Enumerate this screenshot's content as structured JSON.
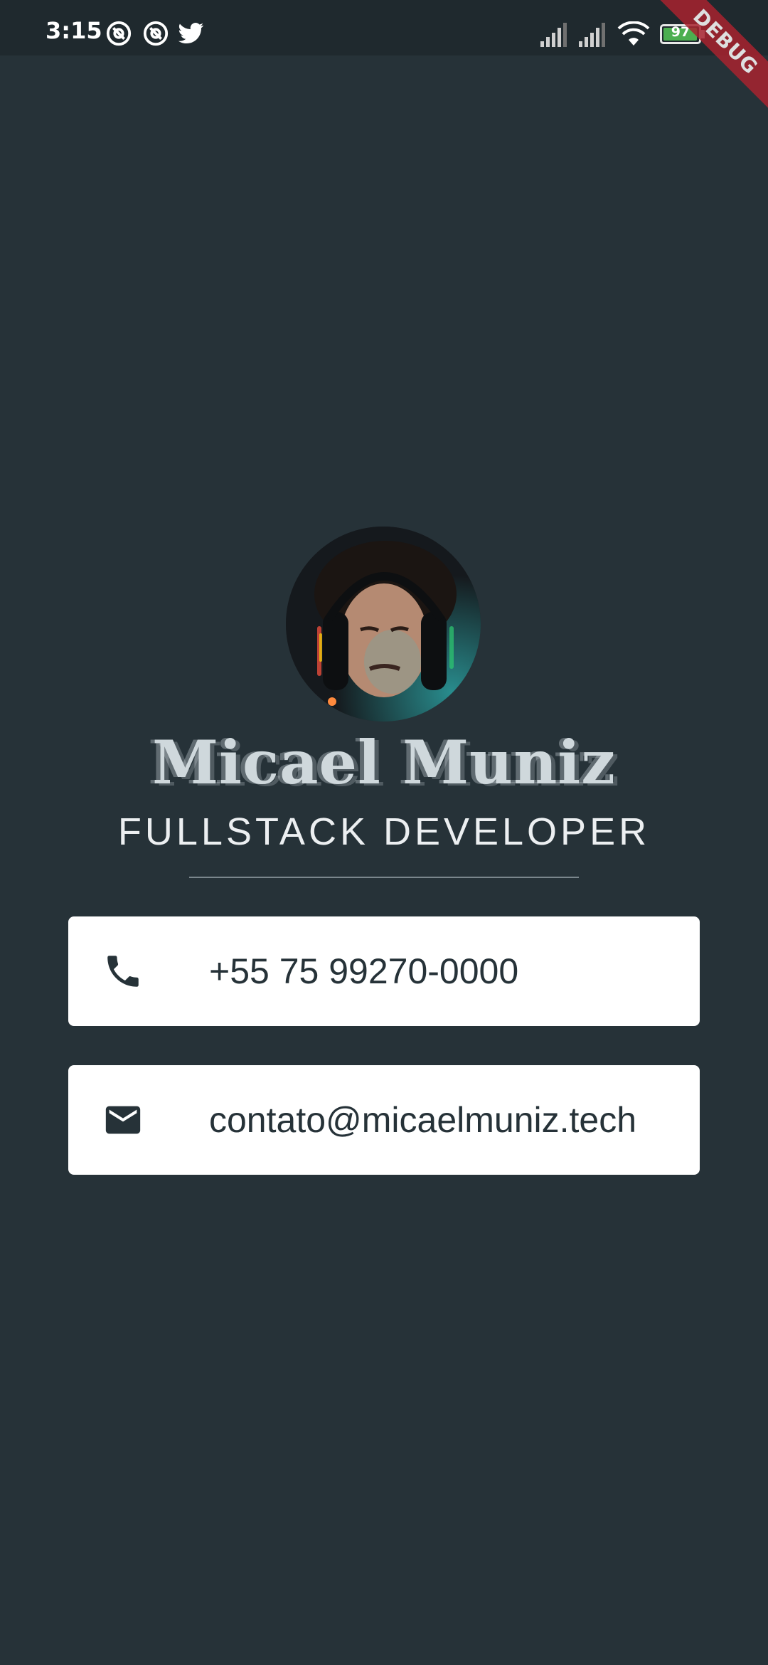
{
  "status_bar": {
    "time": "3:15",
    "battery": "97",
    "battery_level": 0.97,
    "debug_banner": "DEBUG",
    "icons": [
      "at-sign-icon",
      "at-sign-icon",
      "twitter-icon",
      "signal-icon",
      "signal-icon",
      "wifi-icon",
      "battery-icon"
    ]
  },
  "profile": {
    "avatar": "avatar-photo",
    "name": "Micael Muniz",
    "role": "FULLSTACK DEVELOPER"
  },
  "contacts": [
    {
      "icon": "phone-icon",
      "text": "+55 75 99270-0000"
    },
    {
      "icon": "email-icon",
      "text": "contato@micaelmuniz.tech"
    }
  ],
  "colors": {
    "background": "#263238",
    "card": "#ffffff",
    "text_dark": "#263238",
    "debug_banner": "#a8232f"
  }
}
